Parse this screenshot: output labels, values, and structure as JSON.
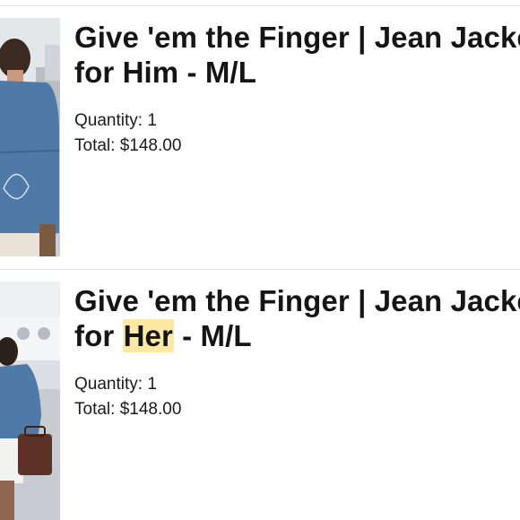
{
  "items": [
    {
      "title_line1": "Give 'em the Finger | Jean Jacket",
      "title_line2_prefix": "for ",
      "title_line2_highlight": "",
      "title_line2_plain": "Him",
      "title_line2_suffix": " - M/L",
      "quantity_label": "Quantity: ",
      "quantity": "1",
      "total_label": "Total: ",
      "total": "$148.00",
      "image_icon": "product-photo-man-denim-jacket"
    },
    {
      "title_line1": "Give 'em the Finger | Jean Jacket",
      "title_line2_prefix": "for ",
      "title_line2_highlight": "Her",
      "title_line2_plain": "",
      "title_line2_suffix": " - M/L",
      "quantity_label": "Quantity: ",
      "quantity": "1",
      "total_label": "Total: ",
      "total": "$148.00",
      "image_icon": "product-photo-woman-denim-jacket"
    }
  ],
  "colors": {
    "highlight": "#fde9a6",
    "divider": "#e3e3e3",
    "denim": "#4f79a6"
  }
}
